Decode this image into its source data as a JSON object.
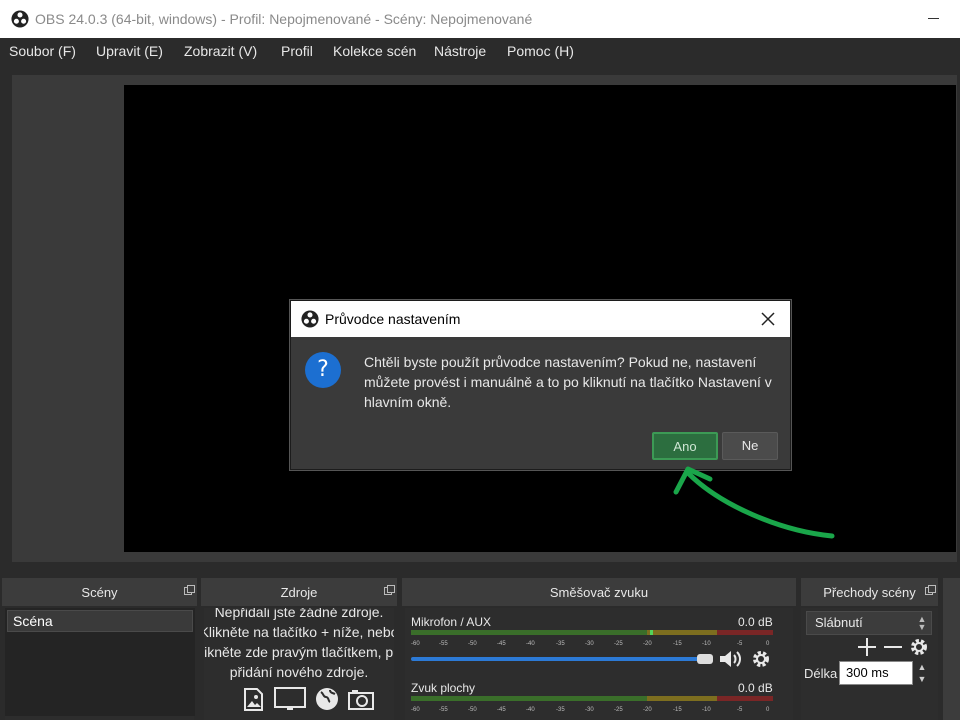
{
  "window": {
    "title": "OBS 24.0.3 (64-bit, windows) - Profil: Nepojmenované - Scény: Nepojmenované"
  },
  "menu": {
    "items": [
      "Soubor (F)",
      "Upravit (E)",
      "Zobrazit (V)",
      "Profil",
      "Kolekce scén",
      "Nástroje",
      "Pomoc (H)"
    ]
  },
  "docks": {
    "scenes": {
      "title": "Scény",
      "items": [
        "Scéna"
      ]
    },
    "sources": {
      "title": "Zdroje",
      "empty_lines": [
        "Nepřidali jste žádné zdroje.",
        "Klikněte na tlačítko + níže, nebo",
        "klikněte zde pravým tlačítkem, pro",
        "přidání nového zdroje."
      ]
    },
    "mixer": {
      "title": "Směšovač zvuku",
      "tracks": [
        {
          "name": "Mikrofon / AUX",
          "db": "0.0 dB"
        },
        {
          "name": "Zvuk plochy",
          "db": "0.0 dB"
        }
      ],
      "ticks": [
        "-60",
        "-55",
        "-50",
        "-45",
        "-40",
        "-35",
        "-30",
        "-25",
        "-20",
        "-15",
        "-10",
        "-5",
        "0"
      ]
    },
    "transitions": {
      "title": "Přechody scény",
      "selected": "Slábnutí",
      "duration_label": "Délka",
      "duration_value": "300 ms"
    }
  },
  "dialog": {
    "title": "Průvodce nastavením",
    "message": "Chtěli byste použít průvodce nastavením? Pokud ne, nastavení můžete provést i manuálně a to po kliknutí na tlačítko Nastavení v hlavním okně.",
    "yes_label": "Ano",
    "no_label": "Ne"
  },
  "colors": {
    "accent_annotation": "#1aa64a",
    "question_icon": "#1c6fd1"
  }
}
